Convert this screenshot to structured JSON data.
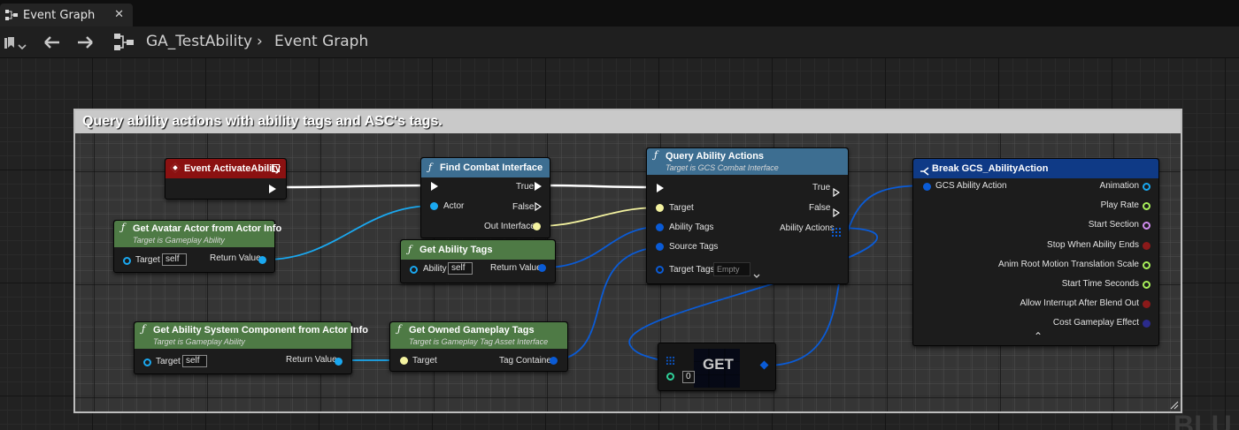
{
  "tab": {
    "label": "Event Graph",
    "close": "✕"
  },
  "breadcrumb": {
    "blueprint": "GA_TestAbility",
    "separator": "›",
    "graph": "Event Graph"
  },
  "comment": {
    "title": "Query ability actions with ability tags and ASC's tags."
  },
  "nodes": {
    "event_activate": {
      "title": "Event ActivateAbility"
    },
    "get_avatar": {
      "title": "Get Avatar Actor from Actor Info",
      "subtitle": "Target is Gameplay Ability",
      "target_label": "Target",
      "target_value": "self",
      "return_label": "Return Value"
    },
    "find_combat": {
      "title": "Find Combat Interface",
      "actor_label": "Actor",
      "true_label": "True",
      "false_label": "False",
      "out_label": "Out Interface"
    },
    "get_ability_tags": {
      "title": "Get Ability Tags",
      "ability_label": "Ability",
      "ability_value": "self",
      "return_label": "Return Value"
    },
    "query_actions": {
      "title": "Query Ability Actions",
      "subtitle": "Target is GCS Combat Interface",
      "target_label": "Target",
      "ability_tags_label": "Ability Tags",
      "source_tags_label": "Source Tags",
      "target_tags_label": "Target Tags",
      "target_tags_value": "Empty",
      "true_label": "True",
      "false_label": "False",
      "actions_label": "Ability Actions"
    },
    "get_asc": {
      "title": "Get Ability System Component from Actor Info",
      "subtitle": "Target is Gameplay Ability",
      "target_label": "Target",
      "target_value": "self",
      "return_label": "Return Value"
    },
    "get_owned_tags": {
      "title": "Get Owned Gameplay Tags",
      "subtitle": "Target is Gameplay Tag Asset Interface",
      "target_label": "Target",
      "container_label": "Tag Container"
    },
    "get_array": {
      "title": "GET",
      "index_value": "0"
    },
    "break_action": {
      "title": "Break GCS_AbilityAction",
      "input_label": "GCS Ability Action",
      "outputs": [
        "Animation",
        "Play Rate",
        "Start Section",
        "Stop When Ability Ends",
        "Anim Root Motion Translation Scale",
        "Start Time Seconds",
        "Allow Interrupt After Blend Out",
        "Cost Gameplay Effect"
      ],
      "collapse": "⌃"
    }
  },
  "watermark": "BLU",
  "colors": {
    "exec": "#ffffff",
    "object": "#1aa8f0",
    "struct": "#0a5bd6",
    "interface": "#f4f3a0",
    "float": "#a8f05a",
    "name": "#d08cf0",
    "bool": "#8b1a1a",
    "asset": "#2b2b8c"
  }
}
